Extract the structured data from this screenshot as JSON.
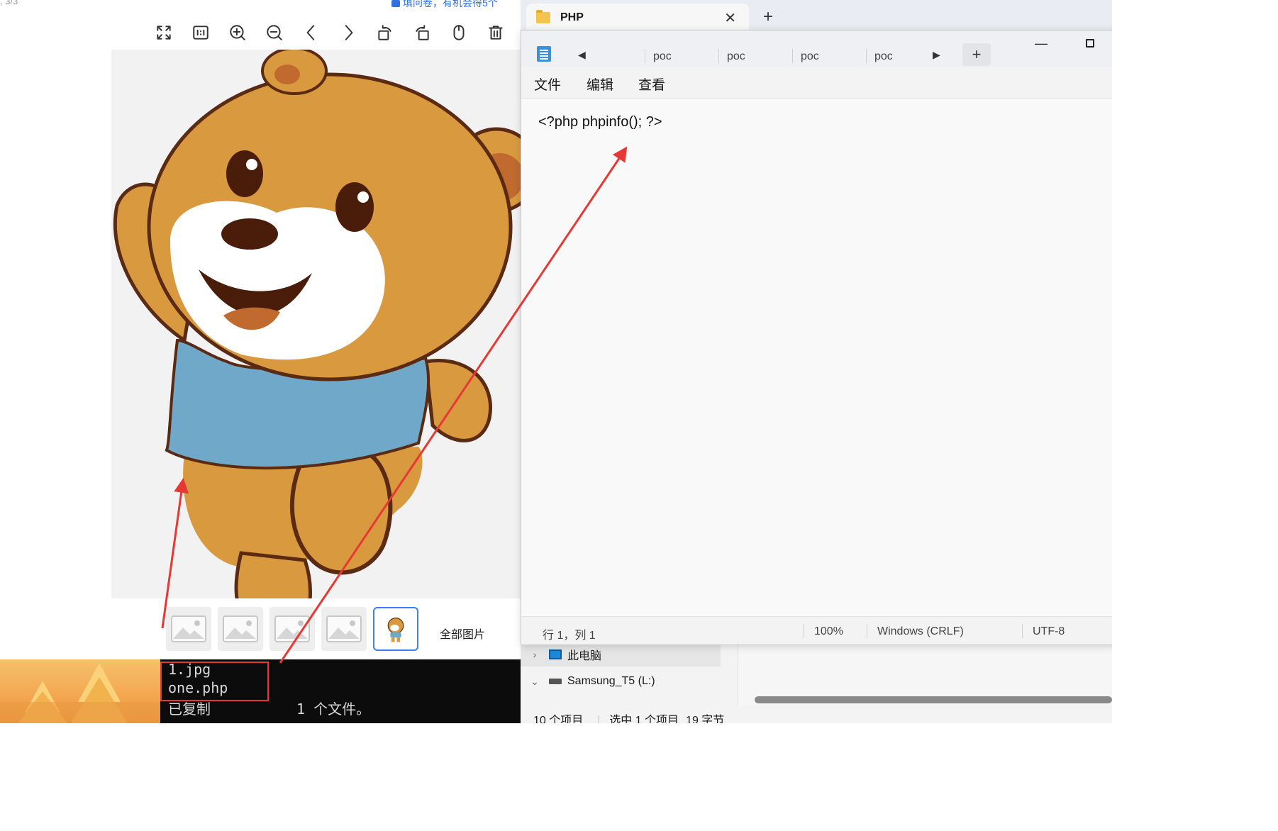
{
  "viewer": {
    "top_left_fragment": ", 3/3",
    "top_notice": "填问卷，有机会得5个",
    "toolbar": [
      {
        "name": "fullscreen-icon",
        "icon": "expand"
      },
      {
        "name": "actual-size-icon",
        "icon": "1:1"
      },
      {
        "name": "zoom-in-icon",
        "icon": "zoom-in"
      },
      {
        "name": "zoom-out-icon",
        "icon": "zoom-out"
      },
      {
        "name": "previous-icon",
        "icon": "chevron-left"
      },
      {
        "name": "next-icon",
        "icon": "chevron-right"
      },
      {
        "name": "rotate-left-icon",
        "icon": "rotate-ccw"
      },
      {
        "name": "rotate-right-icon",
        "icon": "rotate-cw"
      },
      {
        "name": "mouse-icon",
        "icon": "mouse"
      },
      {
        "name": "delete-icon",
        "icon": "trash"
      }
    ],
    "thumbnails_count": 5,
    "active_thumbnail_index": 4,
    "all_images_label": "全部图片"
  },
  "terminal": {
    "lines": [
      "1.jpg",
      "one.php",
      "已复制",
      "1 个文件。"
    ]
  },
  "explorer": {
    "tab_title": "PHP",
    "tab_close_symbol": "✕",
    "new_tab_symbol": "+",
    "tree": [
      {
        "label": "此电脑",
        "chevron": "›",
        "icon": "computer-icon"
      },
      {
        "label": "Samsung_T5 (L:)",
        "chevron": "⌄",
        "icon": "drive-icon"
      }
    ],
    "status": {
      "items_count": "10 个项目",
      "selected": "选中 1 个项目",
      "size": "19 字节"
    }
  },
  "notepad": {
    "tabs": [
      "poc",
      "poc",
      "poc",
      "poc"
    ],
    "new_tab_symbol": "+",
    "minimize_symbol": "—",
    "menu": {
      "file": "文件",
      "edit": "编辑",
      "view": "查看"
    },
    "content": "<?php phpinfo(); ?>",
    "status": {
      "position": "行 1，列 1",
      "zoom": "100%",
      "line_ending": "Windows (CRLF)",
      "encoding": "UTF-8"
    }
  },
  "colors": {
    "accent": "#3a7ff6",
    "annotation_red": "#e53935",
    "bear_fur": "#d99a3f",
    "bear_shirt": "#6fa8c8"
  }
}
